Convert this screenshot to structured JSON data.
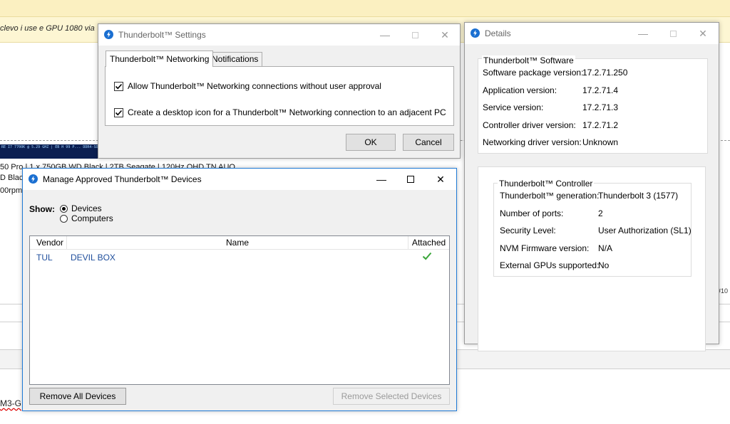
{
  "background": {
    "notice_text": "clevo i use e GPU 1080 via",
    "sig_banner": "RE I7 7700K @ 5.29 GHZ | EB H 99 P... DDR4-SDRAM @ 1599.7MHZ (18-18-... 700M POWERED BY PREMAMOD.COM!!",
    "sig_line1": "50 Pro | 1 x 750GB WD Black | 2TB Seagate | 120Hz QHD TN AUO",
    "sig_line2": "D Blac",
    "sig_line3": "00rpm",
    "post_number": "#10",
    "bottom_text": "M3-G"
  },
  "settings_dialog": {
    "title": "Thunderbolt™ Settings",
    "tabs": [
      {
        "label": "Thunderbolt™ Networking"
      },
      {
        "label": "Notifications"
      }
    ],
    "options": [
      {
        "label": "Allow Thunderbolt™ Networking connections without user approval",
        "checked": true
      },
      {
        "label": "Create a desktop icon for a Thunderbolt™ Networking connection to an adjacent PC",
        "checked": true
      }
    ],
    "ok_label": "OK",
    "cancel_label": "Cancel"
  },
  "details_window": {
    "title": "Details",
    "software": {
      "title": "Thunderbolt™ Software",
      "rows": [
        {
          "label": "Software package version:",
          "value": "17.2.71.250"
        },
        {
          "label": "Application version:",
          "value": "17.2.71.4"
        },
        {
          "label": "Service version:",
          "value": "17.2.71.3"
        },
        {
          "label": "Controller driver version:",
          "value": "17.2.71.2"
        },
        {
          "label": "Networking driver version:",
          "value": "Unknown"
        }
      ]
    },
    "controller": {
      "title": "Thunderbolt™ Controller",
      "rows": [
        {
          "label": "Thunderbolt™ generation:",
          "value": "Thunderbolt 3 (1577)"
        },
        {
          "label": "Number of ports:",
          "value": "2"
        },
        {
          "label": "Security Level:",
          "value": "User Authorization (SL1)"
        },
        {
          "label": "NVM Firmware version:",
          "value": "N/A"
        },
        {
          "label": "External GPUs supported:",
          "value": "No"
        }
      ]
    }
  },
  "manage_window": {
    "title": "Manage Approved Thunderbolt™ Devices",
    "show_label": "Show:",
    "radio_options": [
      {
        "label": "Devices",
        "selected": true
      },
      {
        "label": "Computers",
        "selected": false
      }
    ],
    "columns": [
      "Vendor",
      "Name",
      "Attached"
    ],
    "devices": [
      {
        "vendor": "TUL",
        "name": "DEVIL BOX",
        "attached": true
      }
    ],
    "remove_all_label": "Remove All Devices",
    "remove_selected_label": "Remove Selected Devices"
  },
  "colors": {
    "accent": "#0078d7",
    "thunderbolt_icon": "#1a6fd1",
    "attached_check": "#3aa63a",
    "device_text": "#1f4e9c"
  }
}
